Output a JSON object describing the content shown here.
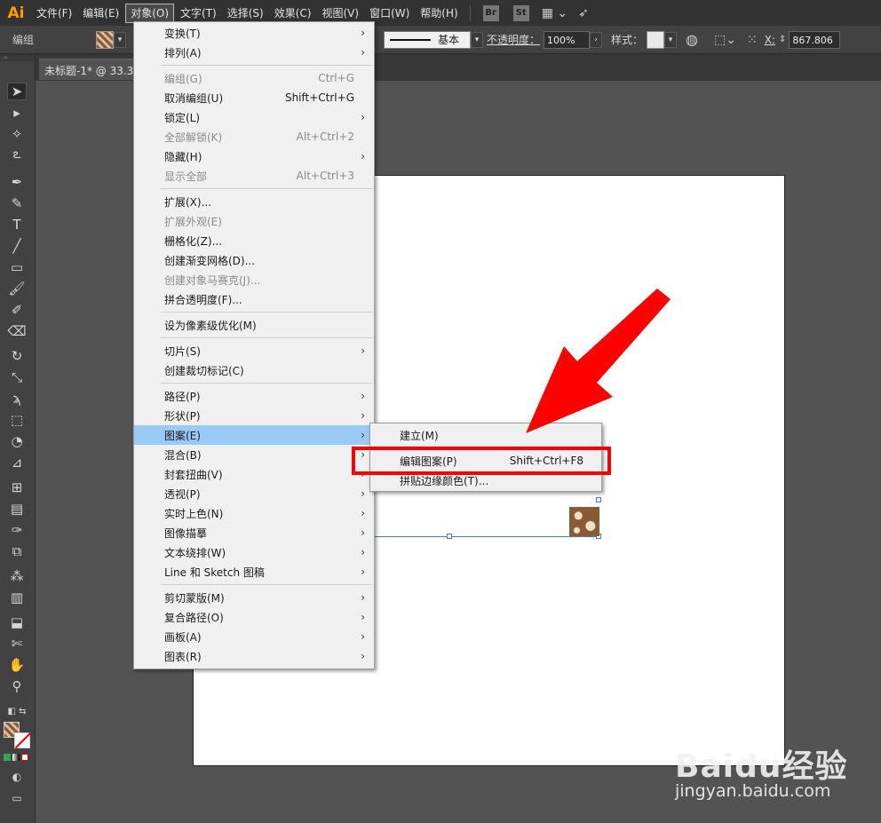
{
  "app": {
    "logo": "Ai"
  },
  "menubar": {
    "items": [
      "文件(F)",
      "编辑(E)",
      "对象(O)",
      "文字(T)",
      "选择(S)",
      "效果(C)",
      "视图(V)",
      "窗口(W)",
      "帮助(H)"
    ],
    "active": "对象(O)",
    "app_buttons": [
      "Br",
      "St"
    ]
  },
  "controlbar": {
    "group_label": "编组",
    "stroke_style": "基本",
    "opacity_label": "不透明度：",
    "opacity_value": "100%",
    "style_label": "样式：",
    "x_label": "X:",
    "x_value": "867.806"
  },
  "document": {
    "tab_title": "未标题-1* @ 33.3"
  },
  "object_menu": {
    "items": [
      {
        "label": "变换(T)",
        "shortcut": "",
        "submenu": true,
        "disabled": false
      },
      {
        "label": "排列(A)",
        "shortcut": "",
        "submenu": true,
        "disabled": false
      },
      {
        "label": "编组(G)",
        "shortcut": "Ctrl+G",
        "submenu": false,
        "disabled": true
      },
      {
        "label": "取消编组(U)",
        "shortcut": "Shift+Ctrl+G",
        "submenu": false,
        "disabled": false
      },
      {
        "label": "锁定(L)",
        "shortcut": "",
        "submenu": true,
        "disabled": false
      },
      {
        "label": "全部解锁(K)",
        "shortcut": "Alt+Ctrl+2",
        "submenu": false,
        "disabled": true
      },
      {
        "label": "隐藏(H)",
        "shortcut": "",
        "submenu": true,
        "disabled": false
      },
      {
        "label": "显示全部",
        "shortcut": "Alt+Ctrl+3",
        "submenu": false,
        "disabled": true
      },
      {
        "label": "扩展(X)...",
        "shortcut": "",
        "submenu": false,
        "disabled": false
      },
      {
        "label": "扩展外观(E)",
        "shortcut": "",
        "submenu": false,
        "disabled": true
      },
      {
        "label": "栅格化(Z)...",
        "shortcut": "",
        "submenu": false,
        "disabled": false
      },
      {
        "label": "创建渐变网格(D)...",
        "shortcut": "",
        "submenu": false,
        "disabled": false
      },
      {
        "label": "创建对象马赛克(J)...",
        "shortcut": "",
        "submenu": false,
        "disabled": true
      },
      {
        "label": "拼合透明度(F)...",
        "shortcut": "",
        "submenu": false,
        "disabled": false
      },
      {
        "label": "设为像素级优化(M)",
        "shortcut": "",
        "submenu": false,
        "disabled": false
      },
      {
        "label": "切片(S)",
        "shortcut": "",
        "submenu": true,
        "disabled": false
      },
      {
        "label": "创建裁切标记(C)",
        "shortcut": "",
        "submenu": false,
        "disabled": false
      },
      {
        "label": "路径(P)",
        "shortcut": "",
        "submenu": true,
        "disabled": false
      },
      {
        "label": "形状(P)",
        "shortcut": "",
        "submenu": true,
        "disabled": false
      },
      {
        "label": "图案(E)",
        "shortcut": "",
        "submenu": true,
        "disabled": false,
        "highlighted": true
      },
      {
        "label": "混合(B)",
        "shortcut": "",
        "submenu": true,
        "disabled": false
      },
      {
        "label": "封套扭曲(V)",
        "shortcut": "",
        "submenu": true,
        "disabled": false
      },
      {
        "label": "透视(P)",
        "shortcut": "",
        "submenu": true,
        "disabled": false
      },
      {
        "label": "实时上色(N)",
        "shortcut": "",
        "submenu": true,
        "disabled": false
      },
      {
        "label": "图像描摹",
        "shortcut": "",
        "submenu": true,
        "disabled": false
      },
      {
        "label": "文本绕排(W)",
        "shortcut": "",
        "submenu": true,
        "disabled": false
      },
      {
        "label": "Line 和 Sketch 图稿",
        "shortcut": "",
        "submenu": true,
        "disabled": false
      },
      {
        "label": "剪切蒙版(M)",
        "shortcut": "",
        "submenu": true,
        "disabled": false
      },
      {
        "label": "复合路径(O)",
        "shortcut": "",
        "submenu": true,
        "disabled": false
      },
      {
        "label": "画板(A)",
        "shortcut": "",
        "submenu": true,
        "disabled": false
      },
      {
        "label": "图表(R)",
        "shortcut": "",
        "submenu": true,
        "disabled": false
      }
    ]
  },
  "pattern_submenu": {
    "items": [
      {
        "label": "建立(M)",
        "shortcut": ""
      },
      {
        "label": "编辑图案(P)",
        "shortcut": "Shift+Ctrl+F8"
      },
      {
        "label": "拼贴边缘颜色(T)...",
        "shortcut": ""
      }
    ]
  },
  "watermark": {
    "logo": "Baidu经验",
    "url": "jingyan.baidu.com"
  },
  "colors": {
    "highlight": "#99c9f5",
    "annotation": "#ff0000",
    "selection": "#3d7bd6",
    "logo": "#ff9a00"
  }
}
